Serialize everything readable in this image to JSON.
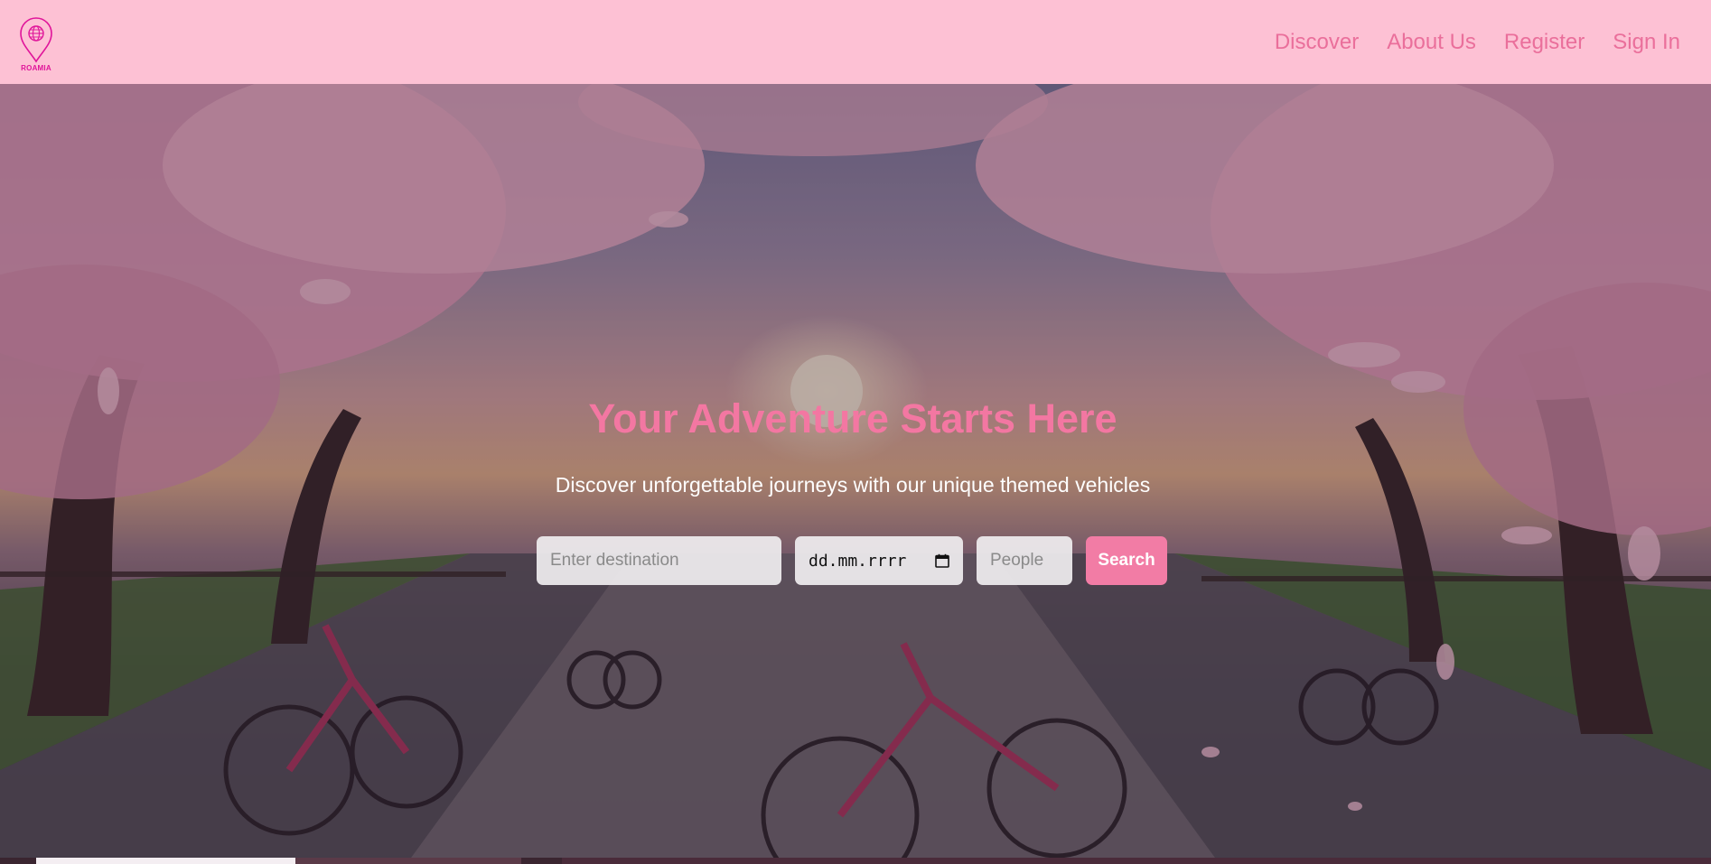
{
  "brand": {
    "name": "ROAMIA",
    "logo_icon": "map-pin-globe-icon",
    "color": "#e0149a"
  },
  "nav": {
    "background": "#fdc1d4",
    "link_color": "#ea6f9b",
    "links": [
      {
        "label": "Discover"
      },
      {
        "label": "About Us"
      },
      {
        "label": "Register"
      },
      {
        "label": "Sign In"
      }
    ]
  },
  "hero": {
    "title": "Your Adventure Starts Here",
    "subtitle": "Discover unforgettable journeys with our unique themed vehicles",
    "title_color": "#f377a2",
    "background_image": "cherry-blossom-avenue-with-cyclists",
    "search": {
      "destination_placeholder": "Enter destination",
      "date_placeholder": "dd.mm.rrrr",
      "date_icon": "calendar-icon",
      "people_placeholder": "People",
      "button_label": "Search",
      "button_color": "#f27ca5"
    }
  }
}
